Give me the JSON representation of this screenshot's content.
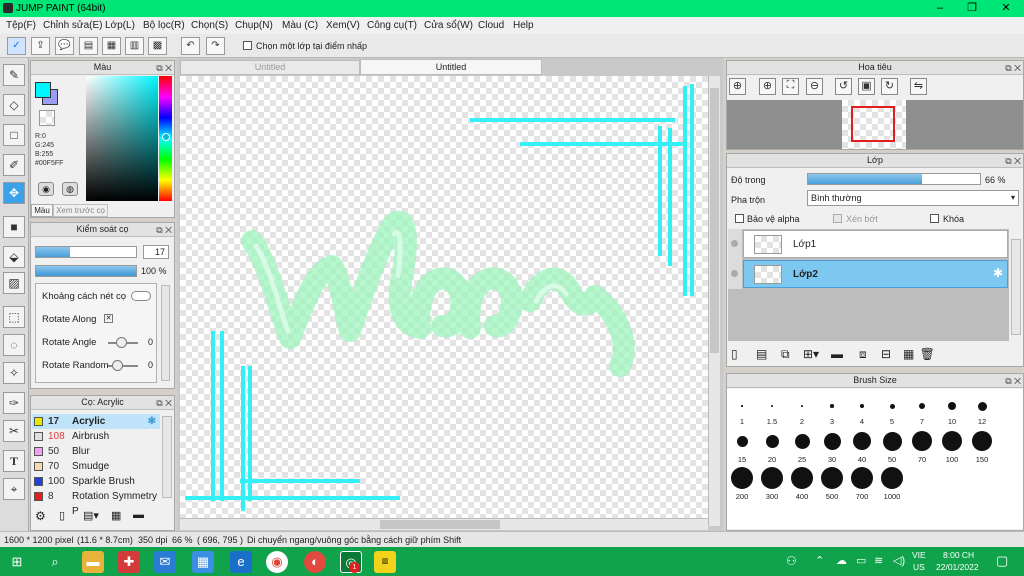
{
  "window": {
    "title": "JUMP PAINT (64bit)",
    "controls": [
      "–",
      "❐",
      "✕"
    ]
  },
  "menu": [
    "Tệp(F)",
    "Chỉnh sửa(E)",
    "Lớp(L)",
    "Bộ lọc(R)",
    "Chọn(S)",
    "Chụp(N)",
    "Màu (C)",
    "Xem(V)",
    "Công cụ(T)",
    "Cửa sổ(W)",
    "Cloud",
    "Help"
  ],
  "toolbar": {
    "checkbox_label": "Chọn một lớp tại điểm nhấp"
  },
  "tabs": [
    "Untitled",
    "Untitled"
  ],
  "color_panel": {
    "title": "Màu",
    "values": [
      "R:0",
      "G:245",
      "B:255"
    ],
    "hex": "#00F5FF",
    "tab_active": "Màu",
    "tab_inactive": "Xem trước cọ",
    "current_color": "#00F5FF"
  },
  "brush_control": {
    "title": "Kiểm soát cọ",
    "size": "17",
    "opacity": "100 %",
    "options": [
      "Khoảng cách nét cọ",
      "Rotate Along",
      "Rotate Angle",
      "Rotate Random"
    ],
    "angle_value": "0",
    "random_value": "0"
  },
  "brush_list": {
    "title": "Cọ: Acrylic",
    "items": [
      {
        "num": "17",
        "name": "Acrylic",
        "color": "#e8e800",
        "selected": true
      },
      {
        "num": "108",
        "name": "Airbrush",
        "color": "#e0e0e0",
        "selected": false
      },
      {
        "num": "50",
        "name": "Blur",
        "color": "#f0a0f0",
        "selected": false
      },
      {
        "num": "70",
        "name": "Smudge",
        "color": "#f8d8b0",
        "selected": false
      },
      {
        "num": "100",
        "name": "Sparkle Brush",
        "color": "#2040e0",
        "selected": false
      },
      {
        "num": "8",
        "name": "Rotation Symmetry P",
        "color": "#e02020",
        "selected": false
      }
    ]
  },
  "navigator": {
    "title": "Hoa tiêu"
  },
  "layer_panel": {
    "title": "Lớp",
    "opacity_label": "Độ trong",
    "opacity_value": "66 %",
    "opacity": 0.66,
    "blend_label": "Pha trộn",
    "blend_value": "Bình thường",
    "protect_alpha": "Bảo vệ alpha",
    "clip": "Xén bớt",
    "lock": "Khóa",
    "layers": [
      {
        "name": "Lớp1",
        "selected": false
      },
      {
        "name": "Lớp2",
        "selected": true
      }
    ]
  },
  "brush_size": {
    "title": "Brush Size",
    "sizes": [
      "1",
      "1.5",
      "2",
      "3",
      "4",
      "5",
      "7",
      "10",
      "12",
      "15",
      "20",
      "25",
      "30",
      "40",
      "50",
      "70",
      "100",
      "150",
      "200",
      "300",
      "400",
      "500",
      "700",
      "1000"
    ]
  },
  "statusbar": {
    "dimensions": "1600 * 1200 pixel",
    "physical": "(11.6 * 8.7cm)",
    "dpi": "350 dpi",
    "zoom": "66 %",
    "coords": "( 696, 795 )",
    "hint": "Di chuyển ngang/vuông góc bằng cách giữ phím Shift"
  },
  "taskbar": {
    "lang": "VIE",
    "region": "US",
    "time": "8:00 CH",
    "date": "22/01/2022",
    "badge": "1"
  }
}
